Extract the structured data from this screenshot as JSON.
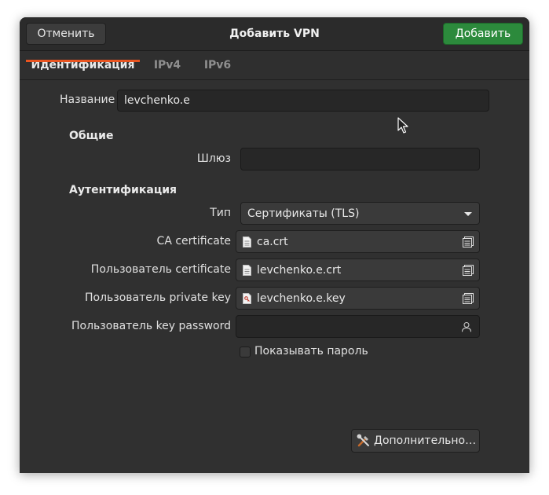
{
  "header": {
    "cancel_label": "Отменить",
    "title": "Добавить VPN",
    "add_label": "Добавить"
  },
  "tabs": [
    {
      "label": "Идентификация",
      "active": true
    },
    {
      "label": "IPv4",
      "active": false
    },
    {
      "label": "IPv6",
      "active": false
    }
  ],
  "form": {
    "name_label": "Название",
    "name_value": "levchenko.e",
    "general_section": "Общие",
    "gateway_label": "Шлюз",
    "gateway_value": "",
    "auth_section": "Аутентификация",
    "type_label": "Тип",
    "type_value": "Сертификаты (TLS)",
    "ca_label": "CA certificate",
    "ca_value": "ca.crt",
    "user_cert_label": "Пользователь certificate",
    "user_cert_value": "levchenko.e.crt",
    "private_key_label": "Пользователь private key",
    "private_key_value": "levchenko.e.key",
    "key_password_label": "Пользователь key password",
    "key_password_value": "",
    "show_password_label": "Показывать пароль",
    "show_password_checked": false
  },
  "footer": {
    "advanced_label": "Дополнительно…"
  },
  "icons": {
    "doc": "document-icon",
    "key_doc": "key-document-icon",
    "folder": "folder-open-icon",
    "user": "user-icon",
    "tools": "tools-icon"
  },
  "colors": {
    "accent": "#e95420",
    "suggested": "#2c8a3c",
    "window_bg": "#303030"
  }
}
